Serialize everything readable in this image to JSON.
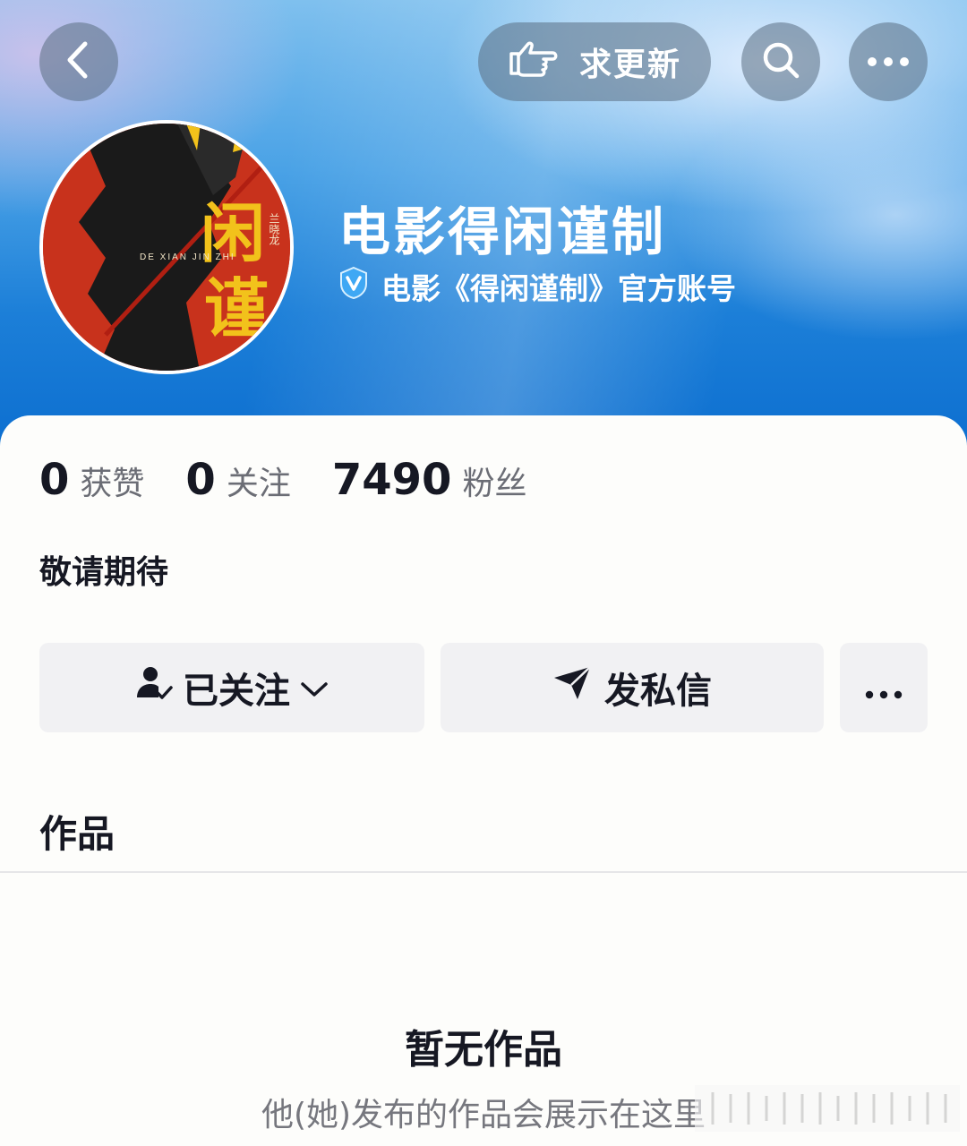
{
  "header": {
    "back_icon": "chevron-left-icon",
    "urge_update_label": "求更新",
    "urge_update_icon": "pointing-hand-icon",
    "search_icon": "search-icon",
    "more_icon": "more-dots-icon"
  },
  "profile": {
    "name": "电影得闲谨制",
    "verified_icon": "verified-v-icon",
    "verification_text": "电影《得闲谨制》官方账号",
    "avatar_poster": {
      "chars_large": [
        "闲",
        "谨"
      ],
      "pinyin": "DE XIAN JIN ZHI",
      "cast_line": "兰晓龙",
      "colors": {
        "background": "#c8321c",
        "silhouette": "#1a1a1a",
        "title": "#f2c21b"
      }
    }
  },
  "stats": [
    {
      "value": "0",
      "label": "获赞"
    },
    {
      "value": "0",
      "label": "关注"
    },
    {
      "value": "7490",
      "label": "粉丝"
    }
  ],
  "bio": "敬请期待",
  "actions": {
    "follow_label": "已关注",
    "follow_icon": "user-check-icon",
    "follow_chevron_icon": "chevron-down-icon",
    "message_label": "发私信",
    "message_icon": "send-icon",
    "more_icon": "more-dots-icon"
  },
  "tabs": {
    "works_label": "作品"
  },
  "empty_state": {
    "title": "暂无作品",
    "description": "他(她)发布的作品会展示在这里"
  },
  "colors": {
    "accent_blue": "#1c7fd8",
    "text_primary": "#161823",
    "text_secondary": "#6b6d75",
    "button_bg": "#f1f1f3"
  }
}
